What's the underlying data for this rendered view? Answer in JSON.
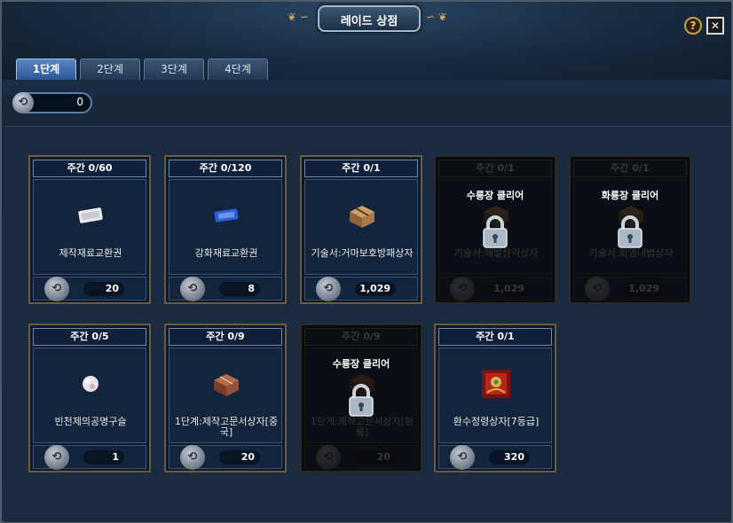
{
  "window": {
    "title": "레이드 상점"
  },
  "controls": {
    "help": "?",
    "close": "✕"
  },
  "tabs": [
    {
      "label": "1단계",
      "active": true
    },
    {
      "label": "2단계",
      "active": false
    },
    {
      "label": "3단계",
      "active": false
    },
    {
      "label": "4단계",
      "active": false
    }
  ],
  "currency": {
    "amount": "0"
  },
  "items": [
    {
      "limit": "주간 0/60",
      "name": "제작재료교환권",
      "price": "20",
      "icon": "white-ticket-icon",
      "locked": false
    },
    {
      "limit": "주간 0/120",
      "name": "강화재료교환권",
      "price": "8",
      "icon": "blue-ticket-icon",
      "locked": false
    },
    {
      "limit": "주간 0/1",
      "name": "기술서:거마보호방패상자",
      "price": "1,029",
      "icon": "supply-box-icon",
      "locked": false
    },
    {
      "limit": "주간 0/1",
      "name": "기술서:해벌상격상자",
      "price": "1,029",
      "icon": "supply-box-icon",
      "locked": true,
      "requirement": "수룡장 클리어"
    },
    {
      "limit": "주간 0/1",
      "name": "기술서:화염내법상자",
      "price": "1,029",
      "icon": "supply-box-icon",
      "locked": true,
      "requirement": "화룡장 클리어"
    },
    {
      "limit": "주간 0/5",
      "name": "빈천제의공명구슬",
      "price": "1",
      "icon": "white-orb-icon",
      "locked": false
    },
    {
      "limit": "주간 0/9",
      "name": "1단계:제작고문서상자[중국]",
      "price": "20",
      "icon": "red-box-icon",
      "locked": false
    },
    {
      "limit": "주간 0/9",
      "name": "1단계:제작고문서상자[환룡]",
      "price": "20",
      "icon": "red-box-icon",
      "locked": true,
      "requirement": "수룡장 클리어"
    },
    {
      "limit": "주간 0/1",
      "name": "환수정령상자[7등급]",
      "price": "320",
      "icon": "spirit-chest-icon",
      "locked": false
    }
  ]
}
